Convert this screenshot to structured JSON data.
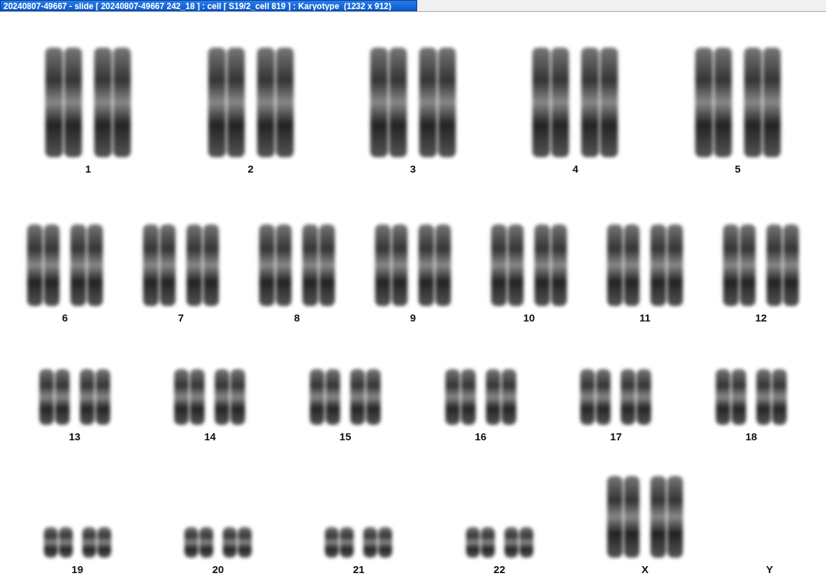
{
  "window": {
    "title": "20240807-49667 - slide [ 20240807-49667 242_18 ] : cell [ S19/2_cell 819 ] : Karyotype  (1232 x 912)"
  },
  "karyotype": {
    "rows": [
      {
        "pairs": [
          {
            "label": "1",
            "kind": "large"
          },
          {
            "label": "2",
            "kind": "large"
          },
          {
            "label": "3",
            "kind": "large"
          },
          {
            "label": "4",
            "kind": "large"
          },
          {
            "label": "5",
            "kind": "large"
          }
        ]
      },
      {
        "pairs": [
          {
            "label": "6",
            "kind": "medium"
          },
          {
            "label": "7",
            "kind": "medium"
          },
          {
            "label": "8",
            "kind": "medium"
          },
          {
            "label": "9",
            "kind": "medium"
          },
          {
            "label": "10",
            "kind": "medium"
          },
          {
            "label": "11",
            "kind": "medium"
          },
          {
            "label": "12",
            "kind": "medium"
          }
        ]
      },
      {
        "pairs": [
          {
            "label": "13",
            "kind": "small"
          },
          {
            "label": "14",
            "kind": "small"
          },
          {
            "label": "15",
            "kind": "small"
          },
          {
            "label": "16",
            "kind": "small"
          },
          {
            "label": "17",
            "kind": "small"
          },
          {
            "label": "18",
            "kind": "small"
          }
        ]
      },
      {
        "pairs": [
          {
            "label": "19",
            "kind": "tiny"
          },
          {
            "label": "20",
            "kind": "tiny"
          },
          {
            "label": "21",
            "kind": "tiny"
          },
          {
            "label": "22",
            "kind": "tiny"
          },
          {
            "label": "X",
            "kind": "medium"
          },
          {
            "label": "Y",
            "kind": "absent"
          }
        ]
      }
    ]
  }
}
